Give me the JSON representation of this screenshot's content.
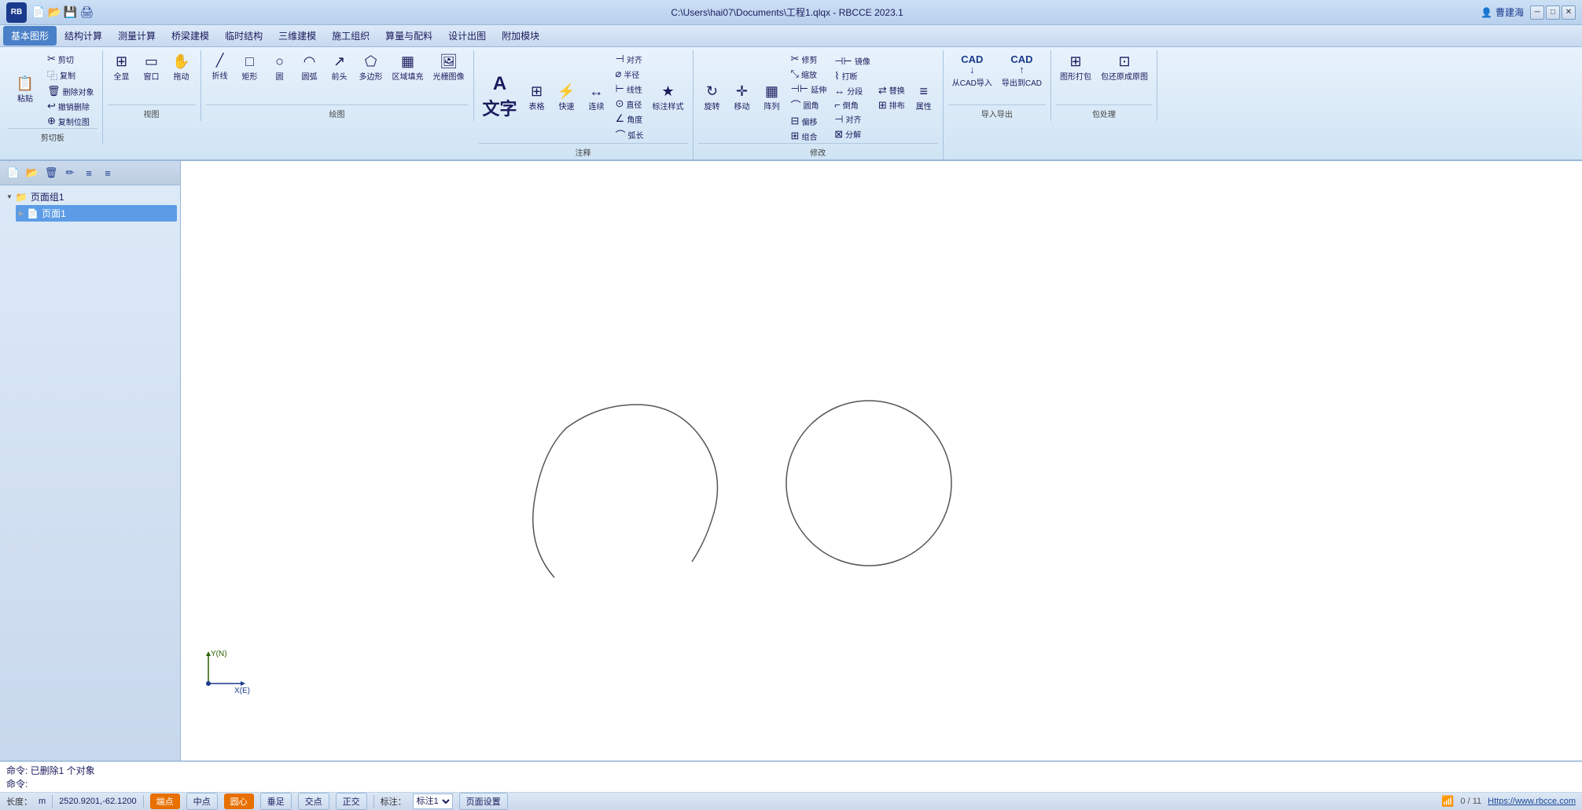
{
  "titlebar": {
    "title": "C:\\Users\\hai07\\Documents\\工程1.qlqx - RBCCE 2023.1",
    "user": "曹建海",
    "logo_text": "RB",
    "controls": [
      "─",
      "□",
      "✕"
    ]
  },
  "menubar": {
    "items": [
      "基本图形",
      "结构计算",
      "测量计算",
      "桥梁建模",
      "临时结构",
      "三维建模",
      "施工组织",
      "算量与配料",
      "设计出图",
      "附加模块"
    ]
  },
  "ribbon": {
    "groups": [
      {
        "label": "剪切板",
        "buttons": [
          {
            "id": "paste",
            "icon": "📋",
            "label": "粘贴"
          },
          {
            "id": "cut",
            "icon": "✂",
            "label": "剪切"
          },
          {
            "id": "copy",
            "icon": "⿻",
            "label": "复制"
          }
        ],
        "small_buttons": [
          {
            "id": "delete-obj",
            "icon": "🗑",
            "label": "删除对象"
          },
          {
            "id": "undo",
            "icon": "↩",
            "label": "撤销删除"
          },
          {
            "id": "copy-pos",
            "icon": "⊕",
            "label": "复制位图"
          }
        ]
      },
      {
        "label": "视图",
        "buttons": [
          {
            "id": "fullscreen",
            "icon": "⊞",
            "label": "全显"
          },
          {
            "id": "window",
            "icon": "▭",
            "label": "窗口"
          },
          {
            "id": "drag",
            "icon": "✋",
            "label": "拖动"
          }
        ]
      },
      {
        "label": "绘图",
        "buttons": [
          {
            "id": "fold",
            "icon": "╱",
            "label": "折线"
          },
          {
            "id": "rect",
            "icon": "□",
            "label": "矩形"
          },
          {
            "id": "circle",
            "icon": "○",
            "label": "圆"
          },
          {
            "id": "arc",
            "icon": "◠",
            "label": "圆弧"
          },
          {
            "id": "arrow",
            "icon": "↗",
            "label": "前头"
          },
          {
            "id": "polygon",
            "icon": "⬠",
            "label": "多边形"
          },
          {
            "id": "fill",
            "icon": "▦",
            "label": "区域填充"
          },
          {
            "id": "raster",
            "icon": "🖼",
            "label": "光栅图像"
          }
        ]
      },
      {
        "label": "注释",
        "buttons": [
          {
            "id": "text",
            "icon": "A",
            "label": "文字"
          },
          {
            "id": "table",
            "icon": "⊞",
            "label": "表格"
          },
          {
            "id": "fast",
            "icon": "⚡",
            "label": "快速"
          },
          {
            "id": "connect",
            "icon": "↔",
            "label": "连续"
          },
          {
            "id": "align-sym",
            "icon": "⊣",
            "label": "对齐"
          },
          {
            "id": "half-r",
            "icon": "半径",
            "label": "半径"
          },
          {
            "id": "inline",
            "icon": "⊢",
            "label": "线性"
          },
          {
            "id": "diameter",
            "icon": "⊙",
            "label": "直径"
          },
          {
            "id": "angle",
            "icon": "∠",
            "label": "角度"
          },
          {
            "id": "arc-len",
            "icon": "⌒",
            "label": "弧长"
          },
          {
            "id": "mark-style",
            "icon": "★",
            "label": "标注样式"
          }
        ]
      },
      {
        "label": "修改",
        "buttons": [
          {
            "id": "rotate",
            "icon": "↻",
            "label": "旋转"
          },
          {
            "id": "move",
            "icon": "✛",
            "label": "移动"
          },
          {
            "id": "array",
            "icon": "▦",
            "label": "阵列"
          },
          {
            "id": "scale",
            "icon": "⤡",
            "label": "缩放"
          },
          {
            "id": "extend",
            "icon": "⊣⊢",
            "label": "延伸"
          },
          {
            "id": "round",
            "icon": "⌒",
            "label": "圆角"
          },
          {
            "id": "offset",
            "icon": "⊟",
            "label": "偏移"
          },
          {
            "id": "combine",
            "icon": "⊞",
            "label": "组合"
          },
          {
            "id": "mirror",
            "icon": "⊣⊢",
            "label": "镜像"
          },
          {
            "id": "break",
            "icon": "⌇",
            "label": "打断"
          },
          {
            "id": "split",
            "icon": "↔",
            "label": "分段"
          },
          {
            "id": "chamfer",
            "icon": "⌐",
            "label": "倒角"
          },
          {
            "id": "align2",
            "icon": "⊣",
            "label": "对齐"
          },
          {
            "id": "decompose",
            "icon": "⊠",
            "label": "分解"
          },
          {
            "id": "replace",
            "icon": "⇄",
            "label": "替换"
          },
          {
            "id": "distribute",
            "icon": "⊞",
            "label": "排布"
          },
          {
            "id": "prop",
            "icon": "≡",
            "label": "属性"
          }
        ]
      },
      {
        "label": "导入导出",
        "buttons": [
          {
            "id": "cad-import",
            "icon": "CAD↓",
            "label": "从CAD导入"
          },
          {
            "id": "cad-export",
            "icon": "CAD↑",
            "label": "导出到CAD"
          }
        ]
      },
      {
        "label": "包处理",
        "buttons": [
          {
            "id": "pack-shape",
            "icon": "⊞",
            "label": "图形打包"
          },
          {
            "id": "restore",
            "icon": "⊡",
            "label": "包还原成原图"
          }
        ]
      }
    ]
  },
  "sidebar": {
    "tree": [
      {
        "id": "group1",
        "label": "页面组1",
        "level": 0,
        "expanded": true
      },
      {
        "id": "page1",
        "label": "页面1",
        "level": 1,
        "active": true
      }
    ]
  },
  "canvas": {
    "arc_description": "left arc shape",
    "circle_description": "right circle"
  },
  "axis": {
    "y_label": "Y(N)",
    "x_label": "X(E)"
  },
  "command_area": {
    "line1": "命令: 已删除1 个对象",
    "line2": "命令:"
  },
  "statusbar": {
    "length_label": "长度：",
    "length_unit": "m",
    "coords_label": "",
    "coords_value": "2520.9201,-62.1200",
    "snap_buttons": [
      {
        "label": "端点",
        "active": true
      },
      {
        "label": "中点",
        "active": false
      },
      {
        "label": "圆心",
        "active": true
      },
      {
        "label": "垂足",
        "active": false
      },
      {
        "label": "交点",
        "active": false
      },
      {
        "label": "正交",
        "active": false
      }
    ],
    "notation_label": "标注：",
    "notation_value": "标注1",
    "page_setup": "页面设置",
    "count": "0 / 11",
    "link": "Https://www.rbcce.com"
  }
}
